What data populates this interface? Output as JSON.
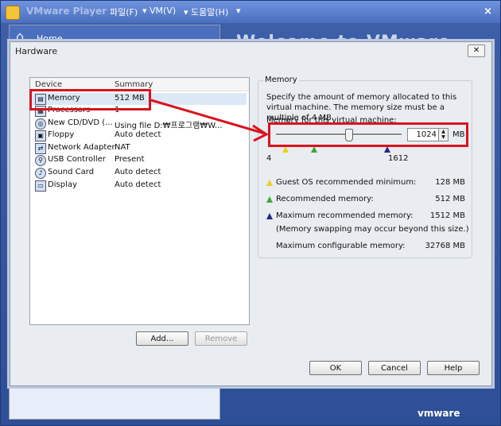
{
  "app": {
    "title": "VMware Player",
    "menus": [
      "파일(F)",
      "VM(V)",
      "도움말(H)"
    ],
    "close_glyph": "×",
    "home_label": "Home",
    "welcome_text": "Welcome to VMware Playe",
    "brand": "vmware"
  },
  "dialog": {
    "title": "Hardware",
    "close_glyph": "✕",
    "list_headers": {
      "device": "Device",
      "summary": "Summary"
    },
    "devices": [
      {
        "name": "Memory",
        "summary": "512 MB",
        "icon": "memory-icon"
      },
      {
        "name": "Processors",
        "summary": "1",
        "icon": "processor-icon"
      },
      {
        "name": "New CD/DVD (...",
        "summary": "Using file D:₩프로그램₩W...",
        "icon": "cd-dvd-icon"
      },
      {
        "name": "Floppy",
        "summary": "Auto detect",
        "icon": "floppy-icon"
      },
      {
        "name": "Network Adapter",
        "summary": "NAT",
        "icon": "network-adapter-icon"
      },
      {
        "name": "USB Controller",
        "summary": "Present",
        "icon": "usb-controller-icon"
      },
      {
        "name": "Sound Card",
        "summary": "Auto detect",
        "icon": "sound-card-icon"
      },
      {
        "name": "Display",
        "summary": "Auto detect",
        "icon": "display-icon"
      }
    ],
    "add_label": "Add...",
    "remove_label": "Remove",
    "ok_label": "OK",
    "cancel_label": "Cancel",
    "help_label": "Help"
  },
  "memory": {
    "group_label": "Memory",
    "description": "Specify the amount of memory allocated to this virtual machine. The memory size must be a multiple of 4 MB.",
    "field_label": "Memory for this virtual machine:",
    "value": "1024",
    "unit": "MB",
    "slider_min": "4",
    "slider_max": "1612",
    "guest_min_label": "Guest OS recommended minimum:",
    "guest_min_value": "128 MB",
    "recommended_label": "Recommended memory:",
    "recommended_value": "512 MB",
    "max_recommended_label": "Maximum recommended memory:",
    "max_recommended_value": "1512 MB",
    "swap_note": "(Memory swapping may occur beyond this size.)",
    "max_config_label": "Maximum configurable memory:",
    "max_config_value": "32768 MB"
  },
  "colors": {
    "highlight": "#d8141e",
    "titlebar": "#4a6fbf"
  }
}
